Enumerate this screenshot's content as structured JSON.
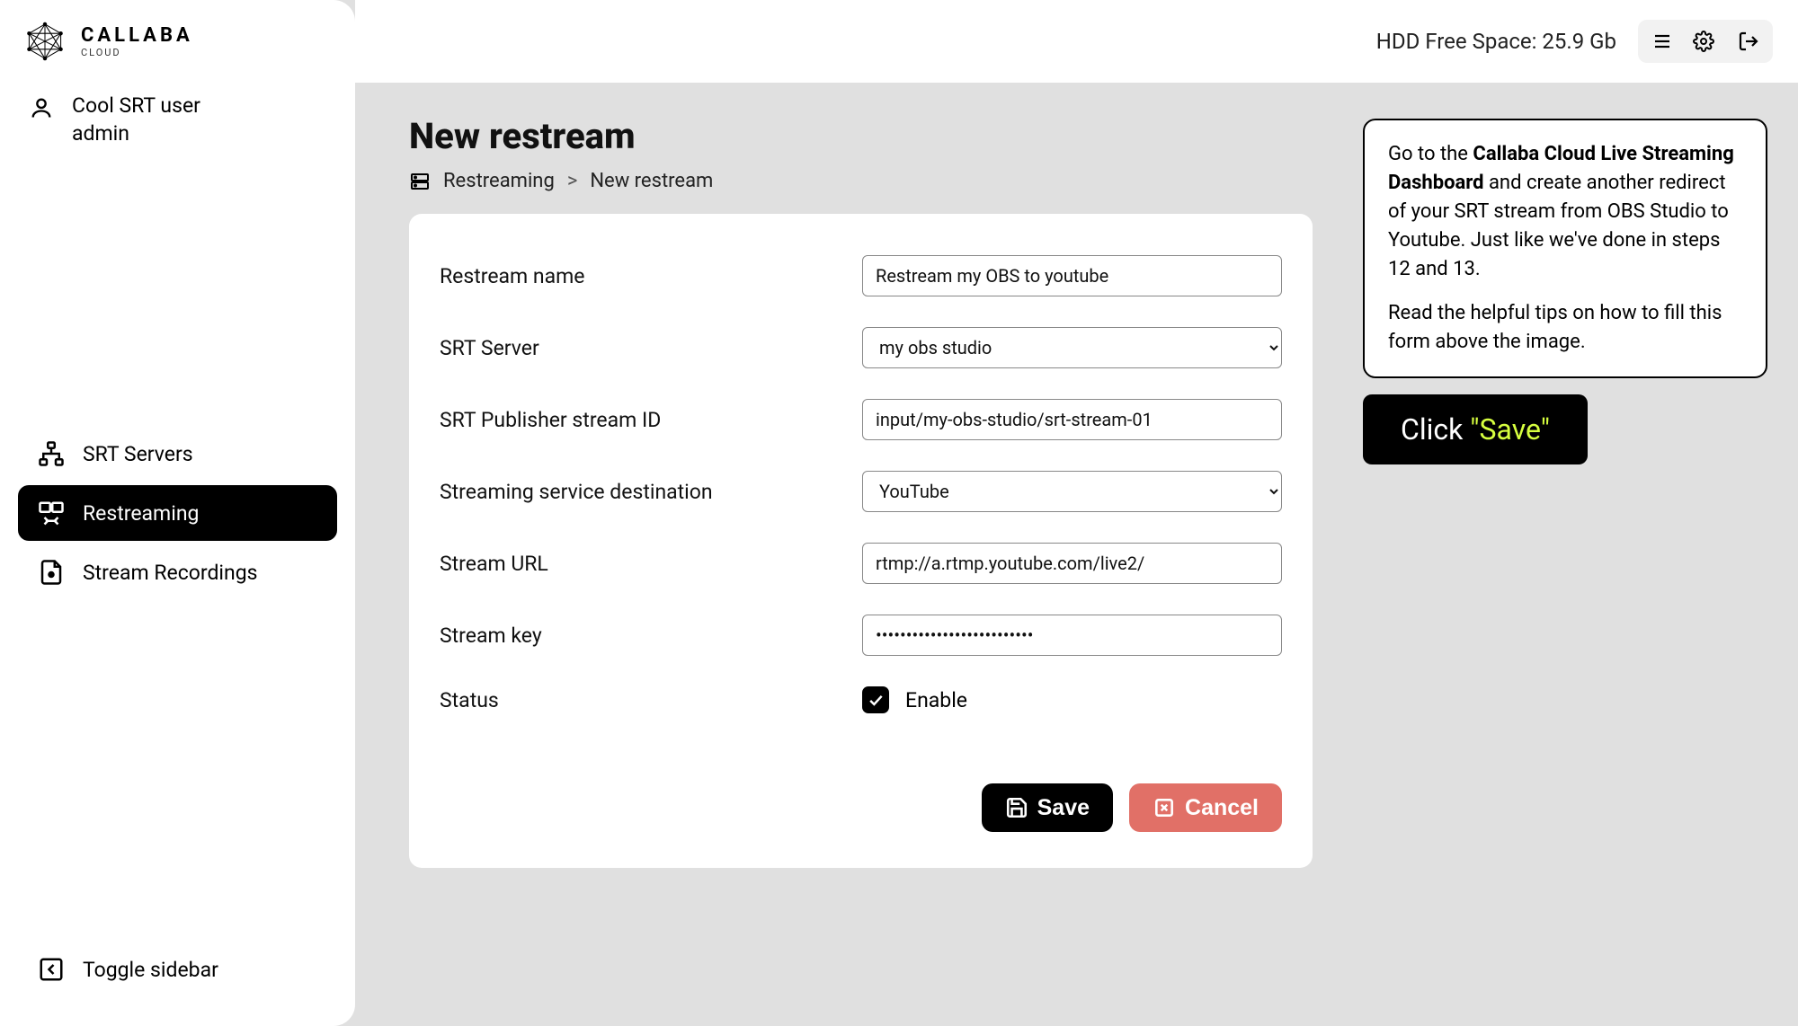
{
  "brand": {
    "name": "CALLABA",
    "sub": "CLOUD"
  },
  "user": {
    "line1": "Cool SRT user",
    "line2": "admin"
  },
  "sidebar": {
    "items": [
      {
        "label": "SRT Servers"
      },
      {
        "label": "Restreaming"
      },
      {
        "label": "Stream Recordings"
      }
    ],
    "toggle": "Toggle sidebar"
  },
  "topbar": {
    "hdd_label": "HDD Free Space: ",
    "hdd_value": "25.9 Gb"
  },
  "page": {
    "title": "New restream",
    "breadcrumb_parent": "Restreaming",
    "breadcrumb_sep": ">",
    "breadcrumb_current": "New restream"
  },
  "form": {
    "restream_name_label": "Restream name",
    "restream_name_value": "Restream my OBS to youtube",
    "srt_server_label": "SRT Server",
    "srt_server_value": "my obs studio",
    "srt_publisher_label": "SRT Publisher stream ID",
    "srt_publisher_value": "input/my-obs-studio/srt-stream-01",
    "destination_label": "Streaming service destination",
    "destination_value": "YouTube",
    "stream_url_label": "Stream URL",
    "stream_url_value": "rtmp://a.rtmp.youtube.com/live2/",
    "stream_key_label": "Stream key",
    "stream_key_value": "••••••••••••••••••••••••••",
    "status_label": "Status",
    "status_enable": "Enable",
    "save": "Save",
    "cancel": "Cancel"
  },
  "hint": {
    "p1_pre": "Go to the ",
    "p1_bold": "Callaba Cloud Live Streaming Dashboard",
    "p1_post": " and create another redirect of your SRT stream from OBS Studio to Youtube. Just like we've done in steps 12 and 13.",
    "p2": "Read the helpful tips on how to fill this form above the image.",
    "callout_pre": "Click ",
    "callout_green": "\"Save\""
  }
}
